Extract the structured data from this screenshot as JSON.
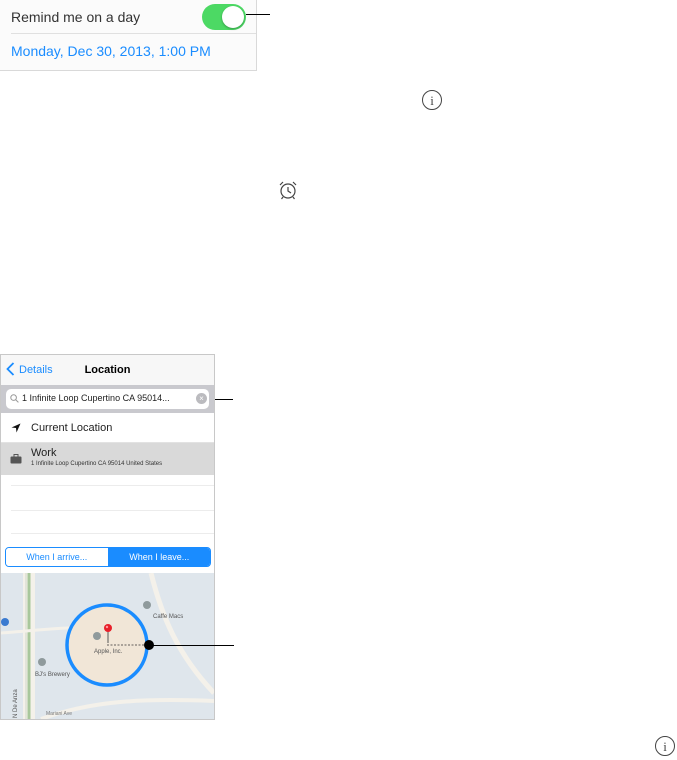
{
  "reminder": {
    "remind_label": "Remind me on a day",
    "toggle_on": true,
    "date_text": "Monday, Dec 30, 2013, 1:00 PM"
  },
  "icons": {
    "info": "i",
    "info_icon_name": "info-icon",
    "alarm_icon_name": "alarm-clock-icon"
  },
  "location": {
    "back_label": "Details",
    "title": "Location",
    "search_value": "1 Infinite Loop Cupertino CA 95014...",
    "current_location_label": "Current Location",
    "work_label": "Work",
    "work_address": "1 Infinite Loop Cupertino CA 95014 United States",
    "when_arrive": "When I arrive...",
    "when_leave": "When I leave...",
    "selected_segment": "When I leave..."
  },
  "map": {
    "labels": {
      "apple_inc": "Apple, Inc.",
      "bjs_brewery": "BJ's Brewery",
      "cafe_macs": "Caffe Macs",
      "street": "Mariani Ave",
      "de_anza": "N De Anza"
    }
  },
  "colors": {
    "accent": "#1a8cff",
    "toggle_on": "#4cd964",
    "pin": "#e8202a",
    "geofence": "#1a8cff"
  }
}
